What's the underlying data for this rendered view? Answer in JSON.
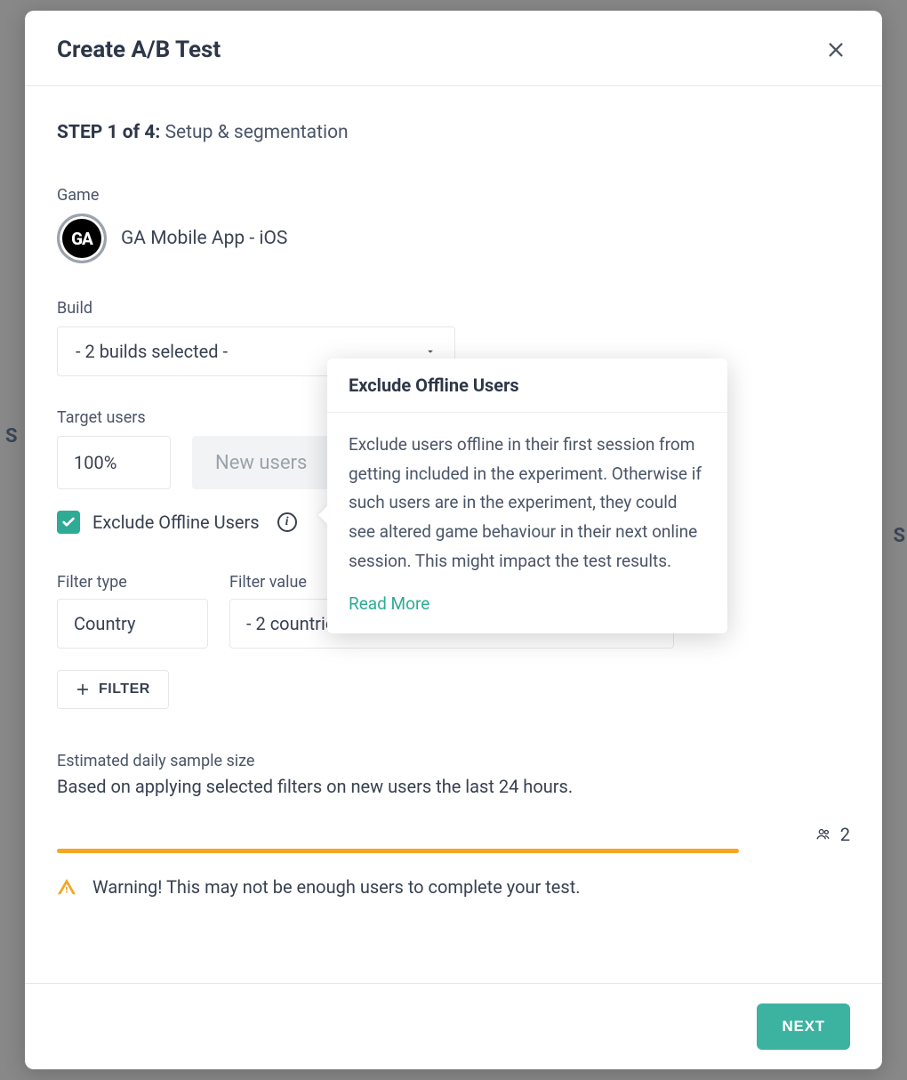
{
  "modal": {
    "title": "Create A/B Test",
    "step_prefix": "STEP 1 of 4:",
    "step_name": "Setup & segmentation"
  },
  "game": {
    "label": "Game",
    "icon_text": "GA",
    "name": "GA Mobile App - iOS"
  },
  "build": {
    "label": "Build",
    "selected": "- 2 builds selected -"
  },
  "target": {
    "label": "Target users",
    "value": "100%",
    "toggle": "New users"
  },
  "exclude": {
    "label": "Exclude Offline Users",
    "checked": true
  },
  "tooltip": {
    "title": "Exclude Offline Users",
    "body": "Exclude users offline in their first session from getting included in the experiment. Otherwise if such users are in the experiment, they could see altered game behaviour in their next online session. This might impact the test results.",
    "link": "Read More"
  },
  "filter": {
    "type_label": "Filter type",
    "type_value": "Country",
    "value_label": "Filter value",
    "value_value": "- 2 countries selected -",
    "add_button": "FILTER"
  },
  "estimate": {
    "label": "Estimated daily sample size",
    "desc": "Based on applying selected filters on new users the last 24 hours.",
    "count": "2",
    "warning": "Warning! This may not be enough users to complete your test."
  },
  "footer": {
    "next": "NEXT"
  },
  "bg": {
    "left_text": "S",
    "right_text": "S"
  }
}
